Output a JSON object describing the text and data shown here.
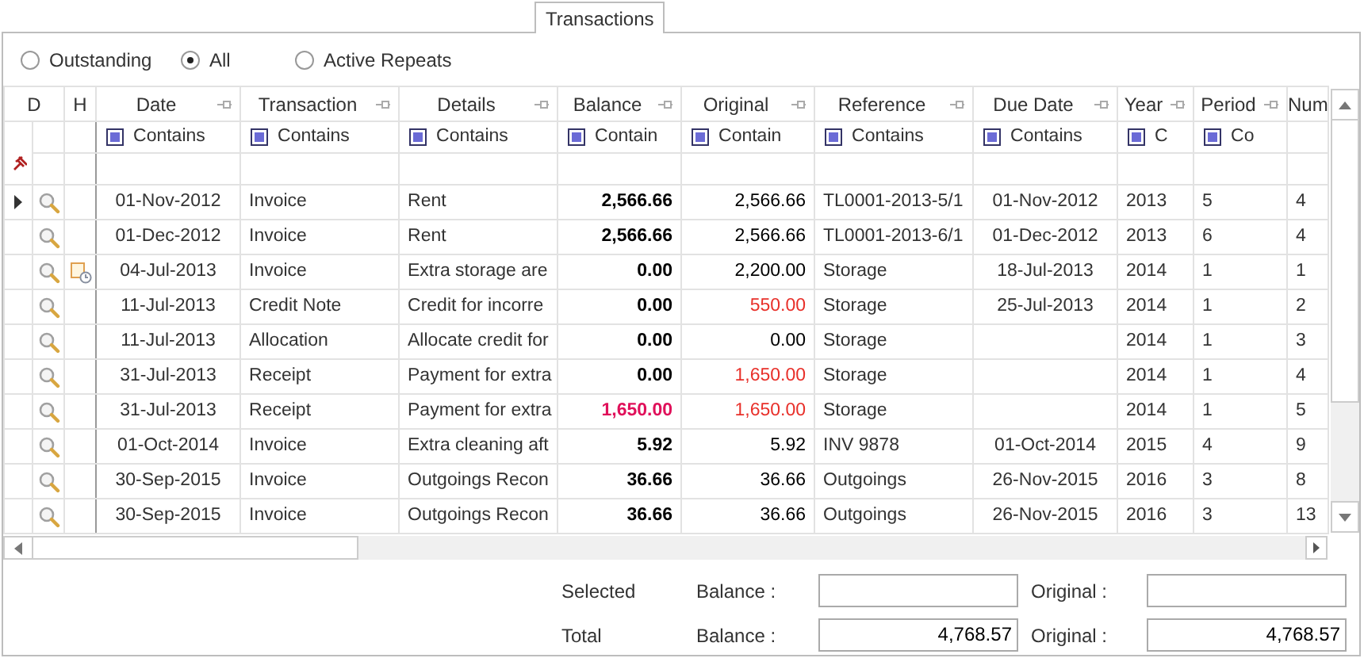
{
  "tabs": [
    {
      "label": "Transactions",
      "selected": true
    }
  ],
  "filter_options": [
    {
      "label": "Outstanding",
      "selected": false
    },
    {
      "label": "All",
      "selected": true
    },
    {
      "label": "Active Repeats",
      "selected": false
    }
  ],
  "table": {
    "columns": [
      "D",
      "H",
      "Date",
      "Transaction",
      "Details",
      "Balance",
      "Original",
      "Reference",
      "Due Date",
      "Year",
      "Period",
      "Num"
    ],
    "filters": [
      "Contains",
      "Contains",
      "Contains",
      "Contain",
      "Contain",
      "Contains",
      "Contains",
      "C",
      "Co"
    ],
    "rows": [
      {
        "current": true,
        "attachment": false,
        "date": "01-Nov-2012",
        "transaction": "Invoice",
        "details": "Rent",
        "balance": "2,566.66",
        "balance_red": false,
        "original": "2,566.66",
        "original_red": false,
        "reference": "TL0001-2013-5/1",
        "due_date": "01-Nov-2012",
        "year": "2013",
        "period": "5",
        "num": "4"
      },
      {
        "current": false,
        "attachment": false,
        "date": "01-Dec-2012",
        "transaction": "Invoice",
        "details": "Rent",
        "balance": "2,566.66",
        "balance_red": false,
        "original": "2,566.66",
        "original_red": false,
        "reference": "TL0001-2013-6/1",
        "due_date": "01-Dec-2012",
        "year": "2013",
        "period": "6",
        "num": "4"
      },
      {
        "current": false,
        "attachment": true,
        "date": "04-Jul-2013",
        "transaction": "Invoice",
        "details": "Extra storage are",
        "balance": "0.00",
        "balance_red": false,
        "original": "2,200.00",
        "original_red": false,
        "reference": "Storage",
        "due_date": "18-Jul-2013",
        "year": "2014",
        "period": "1",
        "num": "1"
      },
      {
        "current": false,
        "attachment": false,
        "date": "11-Jul-2013",
        "transaction": "Credit Note",
        "details": "Credit for incorre",
        "balance": "0.00",
        "balance_red": false,
        "original": "550.00",
        "original_red": true,
        "reference": "Storage",
        "due_date": "25-Jul-2013",
        "year": "2014",
        "period": "1",
        "num": "2"
      },
      {
        "current": false,
        "attachment": false,
        "date": "11-Jul-2013",
        "transaction": "Allocation",
        "details": "Allocate credit for",
        "balance": "0.00",
        "balance_red": false,
        "original": "0.00",
        "original_red": false,
        "reference": "Storage",
        "year": "2014",
        "period": "1",
        "num": "3"
      },
      {
        "current": false,
        "attachment": false,
        "date": "31-Jul-2013",
        "transaction": "Receipt",
        "details": "Payment for extra",
        "balance": "0.00",
        "balance_red": false,
        "original": "1,650.00",
        "original_red": true,
        "reference": "Storage",
        "year": "2014",
        "period": "1",
        "num": "4"
      },
      {
        "current": false,
        "attachment": false,
        "date": "31-Jul-2013",
        "transaction": "Receipt",
        "details": "Payment for extra",
        "balance": "1,650.00",
        "balance_red": true,
        "original": "1,650.00",
        "original_red": true,
        "reference": "Storage",
        "year": "2014",
        "period": "1",
        "num": "5"
      },
      {
        "current": false,
        "attachment": false,
        "date": "01-Oct-2014",
        "transaction": "Invoice",
        "details": "Extra cleaning aft",
        "balance": "5.92",
        "balance_red": false,
        "original": "5.92",
        "original_red": false,
        "reference": "INV 9878",
        "due_date": "01-Oct-2014",
        "year": "2015",
        "period": "4",
        "num": "9"
      },
      {
        "current": false,
        "attachment": false,
        "date": "30-Sep-2015",
        "transaction": "Invoice",
        "details": "Outgoings Recon",
        "balance": "36.66",
        "balance_red": false,
        "original": "36.66",
        "original_red": false,
        "reference": "Outgoings",
        "due_date": "26-Nov-2015",
        "year": "2016",
        "period": "3",
        "num": "8"
      },
      {
        "current": false,
        "attachment": false,
        "date": "30-Sep-2015",
        "transaction": "Invoice",
        "details": "Outgoings Recon",
        "balance": "36.66",
        "balance_red": false,
        "original": "36.66",
        "original_red": false,
        "reference": "Outgoings",
        "due_date": "26-Nov-2015",
        "year": "2016",
        "period": "3",
        "num": "13"
      }
    ]
  },
  "summary": [
    {
      "label": "Selected",
      "balance_label": "Balance :",
      "original_label": "Original :"
    },
    {
      "label": "Total",
      "balance_label": "Balance :",
      "balance": "4,768.57",
      "original_label": "Original :",
      "original": "4,768.57"
    }
  ]
}
